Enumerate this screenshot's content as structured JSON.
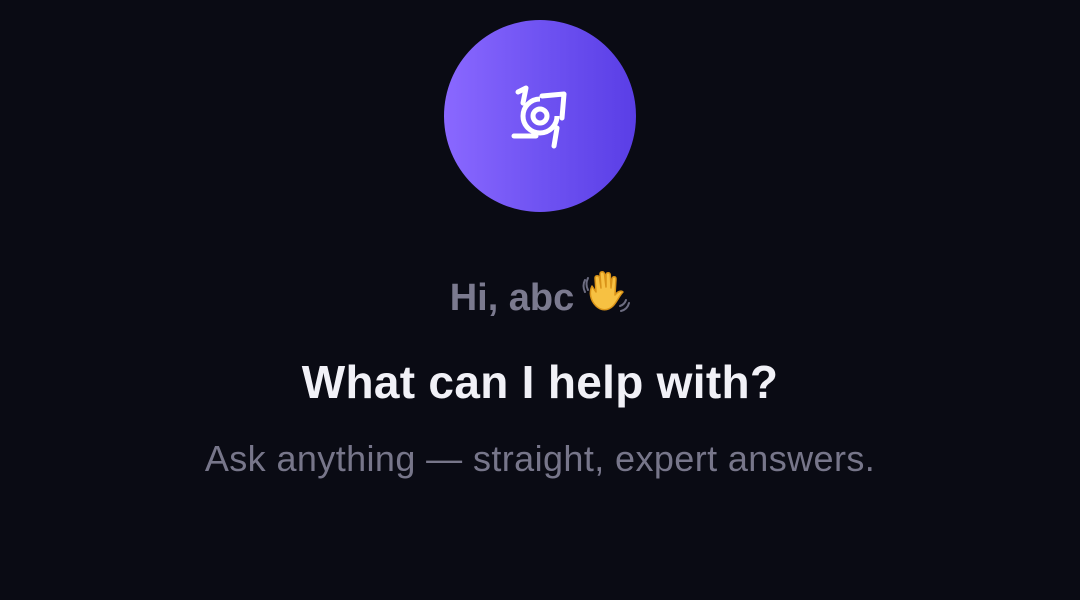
{
  "logo": {
    "icon": "camera-aperture-logo-icon",
    "gradient": [
      "#8a68ff",
      "#5a3ee6"
    ]
  },
  "greeting": {
    "text": "Hi, abc",
    "emoji": "waving-hand-emoji"
  },
  "headline": "What can I help with?",
  "subtitle": "Ask anything — straight, expert answers.",
  "colors": {
    "background": "#0a0b14",
    "greeting": "#7b7a8f",
    "headline": "#f1f1f7",
    "subtitle": "#77768a"
  }
}
